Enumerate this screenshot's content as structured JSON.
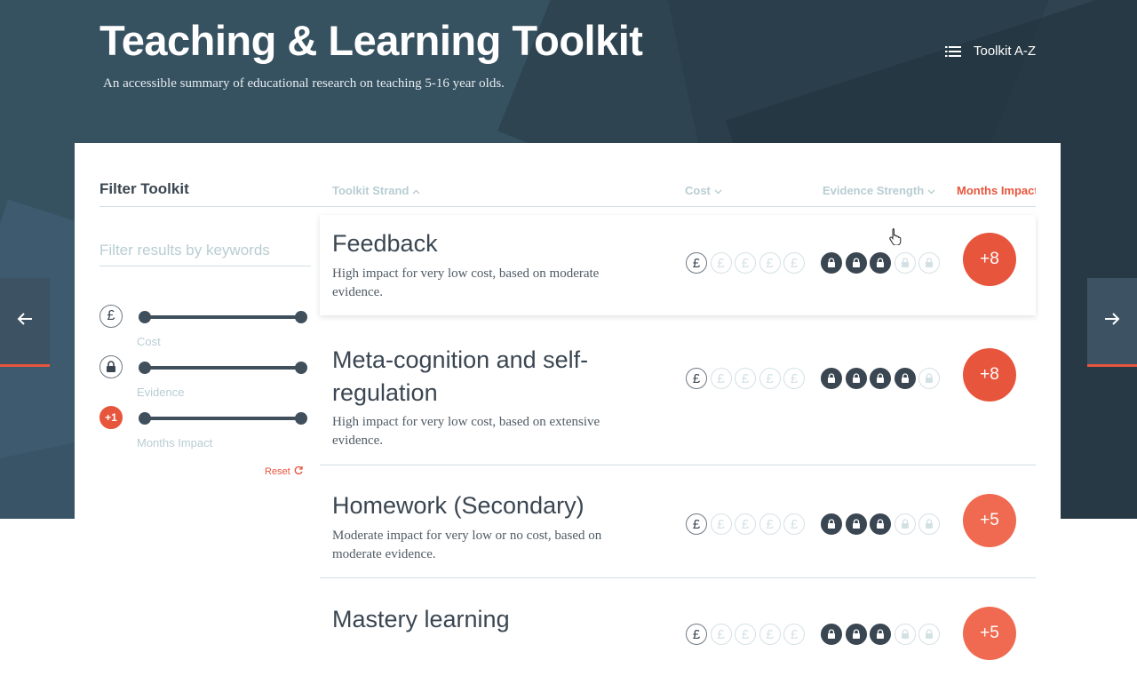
{
  "header": {
    "title": "Teaching & Learning Toolkit",
    "subtitle": "An accessible summary of educational research on teaching 5-16 year olds.",
    "az_link_label": "Toolkit A-Z"
  },
  "filters": {
    "heading": "Filter Toolkit",
    "keyword_placeholder": "Filter results by keywords",
    "sliders": [
      {
        "label": "Cost",
        "icon": "pound-icon",
        "glyph": "£",
        "range": [
          0,
          1
        ]
      },
      {
        "label": "Evidence",
        "icon": "lock-icon",
        "range": [
          0,
          1
        ]
      },
      {
        "label": "Months Impact",
        "icon": "months-impact-badge",
        "badge": "+1",
        "range": [
          0,
          1
        ]
      }
    ],
    "reset_label": "Reset"
  },
  "columns": {
    "strand": "Toolkit Strand",
    "cost": "Cost",
    "evidence": "Evidence Strength",
    "months": "Months Impact"
  },
  "cost_glyph": "£",
  "colors": {
    "accent": "#e8553d",
    "dark": "#3a4651",
    "muted": "#b8cdd3"
  },
  "strands": [
    {
      "title": "Feedback",
      "desc": "High impact for very low cost, based on moderate evidence.",
      "cost": 1,
      "evidence": 3,
      "impact": "+8"
    },
    {
      "title": "Meta-cognition and self-regulation",
      "desc": "High impact for very low cost, based on extensive evidence.",
      "cost": 1,
      "evidence": 4,
      "impact": "+8"
    },
    {
      "title": "Homework (Secondary)",
      "desc": "Moderate impact for very low or no cost, based on moderate evidence.",
      "cost": 1,
      "evidence": 3,
      "impact": "+5"
    },
    {
      "title": "Mastery learning",
      "desc": "",
      "cost": 1,
      "evidence": 3,
      "impact": "+5"
    }
  ]
}
